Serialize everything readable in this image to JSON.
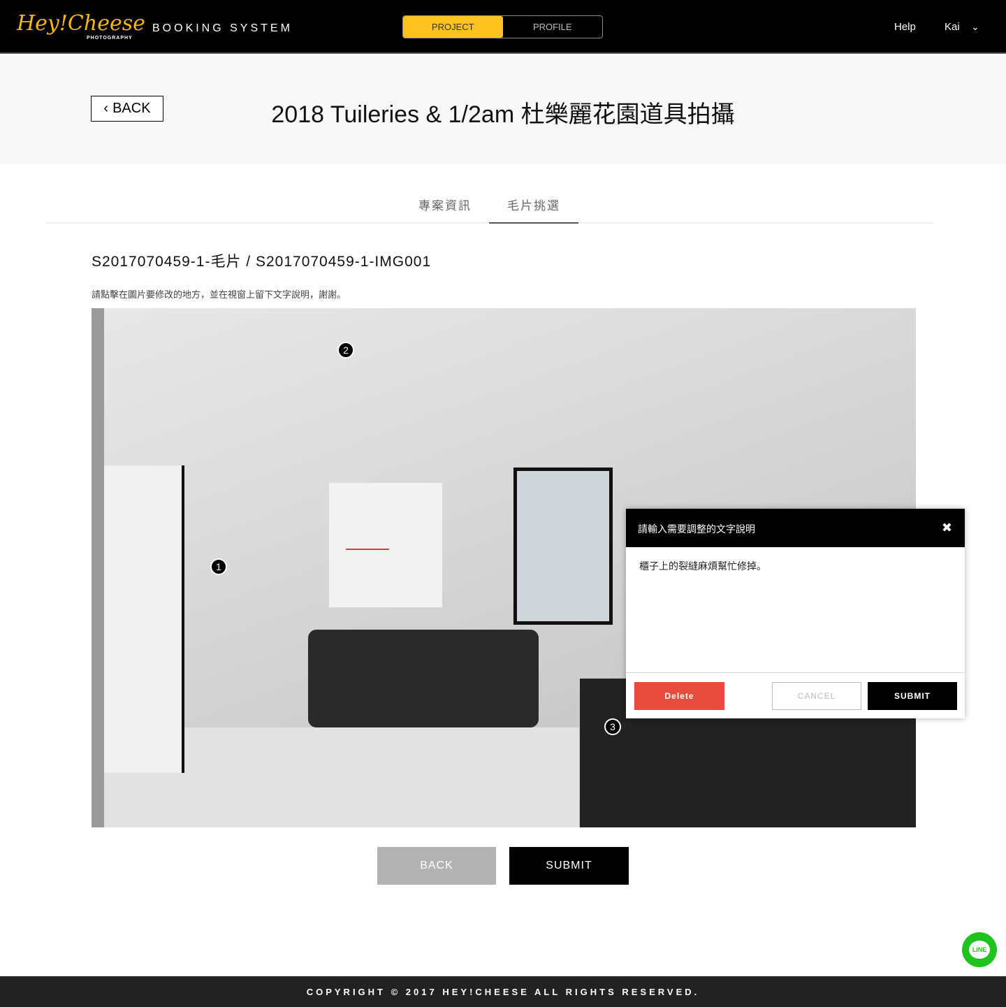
{
  "header": {
    "logo": "Hey!Cheese",
    "logo_sub": "PHOTOGRAPHY",
    "system": "BOOKING SYSTEM",
    "tabs": [
      "PROJECT",
      "PROFILE"
    ],
    "help": "Help",
    "user": "Kai"
  },
  "page": {
    "back": "BACK",
    "title": "2018 Tuileries & 1/2am 杜樂麗花園道具拍攝"
  },
  "tabs": [
    "專案資訊",
    "毛片挑選"
  ],
  "breadcrumb": "S2017070459-1-毛片  /  S2017070459-1-IMG001",
  "hint": "請點擊在圖片要修改的地方，並在視窗上留下文字說明，謝謝。",
  "markers": [
    "1",
    "2",
    "3"
  ],
  "modal": {
    "title": "請輸入需要調整的文字說明",
    "text": "櫃子上的裂縫麻煩幫忙修掉。",
    "delete": "Delete",
    "cancel": "CANCEL",
    "submit": "SUBMIT"
  },
  "actions": {
    "back": "BACK",
    "submit": "SUBMIT"
  },
  "line": "LINE",
  "footer": "COPYRIGHT © 2017 HEY!CHEESE ALL RIGHTS RESERVED.",
  "colors": {
    "accent": "#fec21f",
    "delete": "#e84c3d",
    "line": "#1ec31e"
  }
}
